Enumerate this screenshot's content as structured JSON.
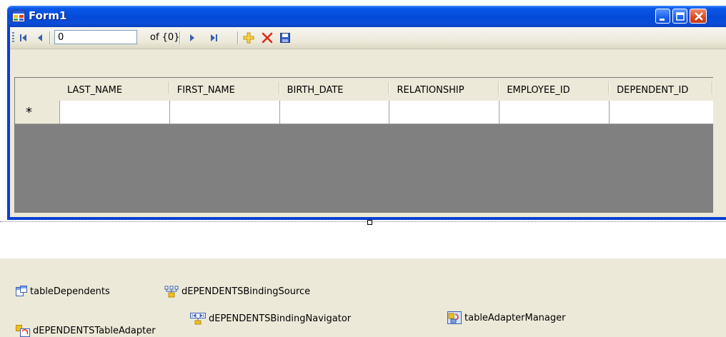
{
  "form": {
    "title": "Form1"
  },
  "navigator": {
    "position_value": "0",
    "count_text": "of {0}",
    "buttons": [
      "move-first",
      "move-previous",
      "move-next",
      "move-last",
      "add-new",
      "delete",
      "save"
    ]
  },
  "grid": {
    "columns": [
      "LAST_NAME",
      "FIRST_NAME",
      "BIRTH_DATE",
      "RELATIONSHIP",
      "EMPLOYEE_ID",
      "DEPENDENT_ID"
    ],
    "new_row_marker": "*"
  },
  "tray": {
    "table_dependents": "tableDependents",
    "binding_source": "dEPENDENTSBindingSource",
    "binding_navigator": "dEPENDENTSBindingNavigator",
    "table_adapter_manager": "tableAdapterManager",
    "table_adapter": "dEPENDENTSTableAdapter"
  },
  "colors": {
    "titlebar": "#0a4dd8",
    "client": "#ece9d8",
    "grid_background": "#808080",
    "close_button": "#d84a20"
  }
}
